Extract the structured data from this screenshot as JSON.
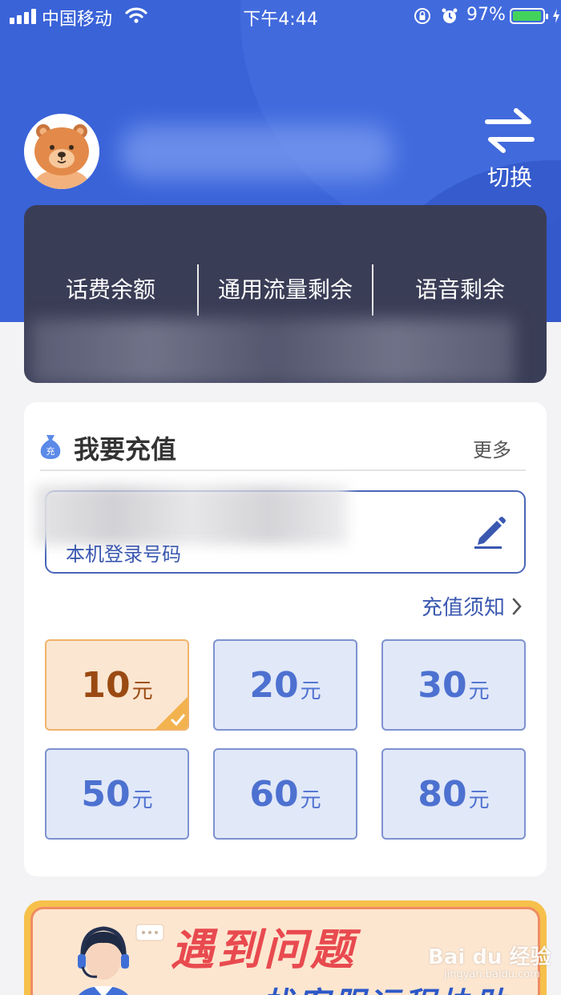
{
  "status_bar": {
    "carrier": "中国移动",
    "time": "下午4:44",
    "battery_percent": "97%",
    "battery_level": 0.97
  },
  "profile": {
    "switch_label": "切换"
  },
  "balance": {
    "columns": [
      "话费余额",
      "通用流量剩余",
      "语音剩余"
    ]
  },
  "recharge": {
    "title": "我要充值",
    "more": "更多",
    "phone_caption": "本机登录号码",
    "notice": "充值须知",
    "unit": "元",
    "amounts": [
      {
        "value": "10",
        "selected": true
      },
      {
        "value": "20",
        "selected": false
      },
      {
        "value": "30",
        "selected": false
      },
      {
        "value": "50",
        "selected": false
      },
      {
        "value": "60",
        "selected": false
      },
      {
        "value": "80",
        "selected": false
      }
    ]
  },
  "banner": {
    "title": "遇到问题",
    "subtitle": "找客服远程协助"
  },
  "watermark": {
    "text": "Bai du 经验",
    "sub": "jingyan.baidu.com"
  },
  "colors": {
    "header_blue": "#3a63d8",
    "card_dark": "#3a3d56",
    "accent_blue": "#3a58b0",
    "selected_orange": "#fbe6d1",
    "banner_red": "#e84a4f"
  }
}
